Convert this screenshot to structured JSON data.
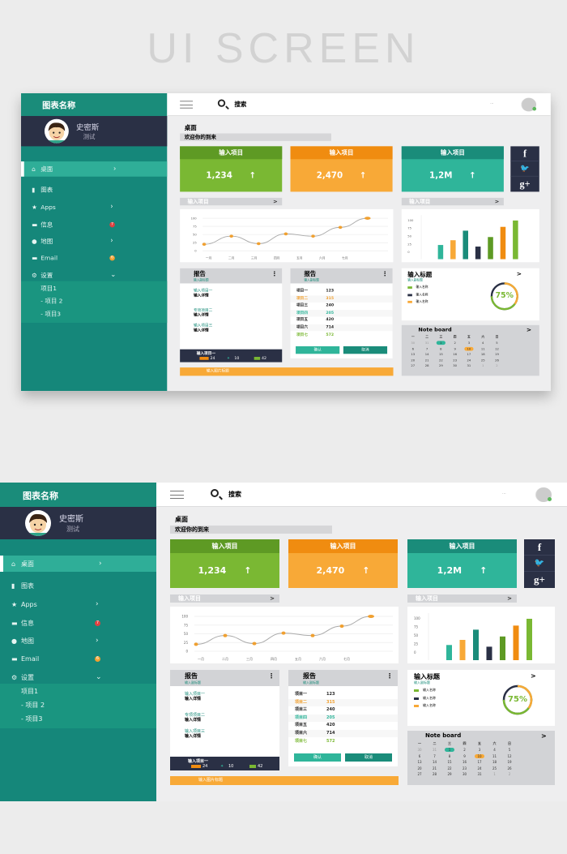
{
  "headline": "UI SCREEN",
  "sidebar": {
    "title": "图表名称",
    "user_name": "史密斯",
    "user_role": "测试",
    "items": [
      {
        "label": "桌面",
        "icon": "home-icon"
      },
      {
        "label": "图表",
        "icon": "bar-chart-icon"
      },
      {
        "label": "Apps",
        "icon": "star-icon"
      },
      {
        "label": "信息",
        "icon": "message-icon",
        "badge": "7"
      },
      {
        "label": "地图",
        "icon": "map-pin-icon"
      },
      {
        "label": "Email",
        "icon": "mail-icon",
        "badge": "6"
      },
      {
        "label": "设置",
        "icon": "gear-icon"
      }
    ],
    "subitems": [
      "项目1",
      "- 项目 2",
      "- 项目3"
    ]
  },
  "topbar": {
    "search_label": "搜索",
    "user_text": "···"
  },
  "page": {
    "title": "桌面",
    "welcome": "欢迎你的到来"
  },
  "cards": [
    {
      "title": "输入项目",
      "value": "1,234",
      "color": "#7ab833",
      "header": "#5e9a24"
    },
    {
      "title": "输入项目",
      "value": "2,470",
      "color": "#f8a937",
      "header": "#f08c10"
    },
    {
      "title": "输入项目",
      "value": "1,2M",
      "color": "#2fb59a",
      "header": "#1a8c7a"
    }
  ],
  "social": [
    "f",
    "🐦",
    "g+"
  ],
  "section_labels": [
    "输入项目",
    "输入项目"
  ],
  "chart_data": [
    {
      "type": "line",
      "categories": [
        "一月",
        "二月",
        "三月",
        "四月",
        "五月",
        "六月",
        "七月"
      ],
      "values": [
        20,
        45,
        22,
        52,
        45,
        72,
        100
      ],
      "ylim": [
        0,
        100
      ],
      "yticks": [
        100,
        75,
        50,
        25,
        0
      ],
      "color": "#f0a030"
    },
    {
      "type": "bar",
      "values": [
        35,
        50,
        80,
        30,
        60,
        92,
        112
      ],
      "ylim": [
        0,
        100
      ],
      "yticks": [
        100,
        75,
        50,
        25,
        0
      ],
      "colors": [
        "#2fb59a",
        "#f8a937",
        "#1a8c7a",
        "#2a3045",
        "#5e9a24",
        "#f08c10",
        "#7ab833"
      ]
    }
  ],
  "report_left": {
    "title": "报告",
    "subtitle": "输入副标题",
    "items": [
      {
        "label": "输入项目一",
        "detail": "输入详情"
      },
      {
        "label": "专项项目二",
        "detail": "输入详情"
      },
      {
        "label": "输入项目三",
        "detail": "输入详情"
      }
    ],
    "footer": "输入项目一",
    "stats": [
      "24",
      "10",
      "42"
    ]
  },
  "report_right": {
    "title": "报告",
    "subtitle": "输入副标题",
    "rows": [
      {
        "name": "项目一",
        "value": "123",
        "color": "#222"
      },
      {
        "name": "项目二",
        "value": "315",
        "color": "#f0a030"
      },
      {
        "name": "项目三",
        "value": "240",
        "color": "#222"
      },
      {
        "name": "项目四",
        "value": "205",
        "color": "#2fb59a"
      },
      {
        "name": "项目五",
        "value": "420",
        "color": "#222"
      },
      {
        "name": "项目六",
        "value": "714",
        "color": "#222"
      },
      {
        "name": "项目七",
        "value": "572",
        "color": "#7ab833"
      }
    ],
    "confirm": "确认",
    "cancel": "取消"
  },
  "stat_card": {
    "title": "输入标题",
    "subtitle": "输入副标题",
    "legend": [
      {
        "label": "输入名称",
        "color": "#7ab833"
      },
      {
        "label": "输入名称",
        "color": "#2a3045"
      },
      {
        "label": "输入名称",
        "color": "#f8a937"
      }
    ],
    "percent": "75%",
    "progress": 75
  },
  "note_board": {
    "title": "Note board",
    "weekdays": [
      "一",
      "二",
      "三",
      "四",
      "五",
      "六",
      "日"
    ],
    "days": [
      "30",
      "31",
      "1",
      "2",
      "3",
      "4",
      "5",
      "6",
      "7",
      "8",
      "9",
      "10",
      "11",
      "12",
      "13",
      "14",
      "15",
      "16",
      "17",
      "18",
      "19",
      "20",
      "21",
      "22",
      "23",
      "24",
      "25",
      "26",
      "27",
      "28",
      "29",
      "30",
      "31",
      "1",
      "2"
    ],
    "highlight_teal": "1",
    "highlight_orange": "12"
  },
  "bottom_bar": "输入图片标题"
}
